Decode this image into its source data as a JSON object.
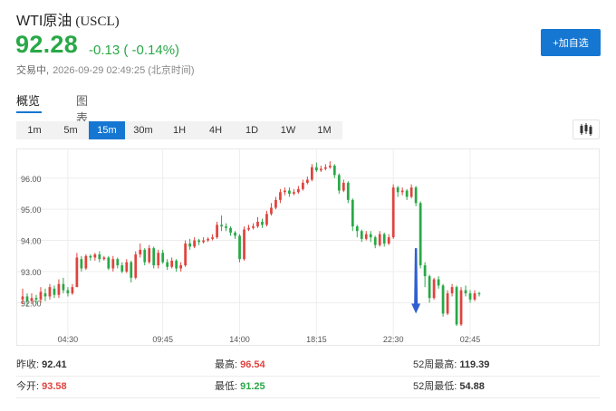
{
  "header": {
    "name": "WTI原油",
    "code": "(USCL)",
    "price": "92.28",
    "change": "-0.13 ( -0.14%)",
    "status": "交易中,",
    "timestamp": "2026-09-29 02:49:25 (北京时间)",
    "watch_label": "+加自选"
  },
  "tabs": [
    {
      "label": "概览",
      "active": true
    },
    {
      "label": "图表",
      "active": false
    }
  ],
  "intervals": [
    {
      "label": "1m",
      "active": false
    },
    {
      "label": "5m",
      "active": false
    },
    {
      "label": "15m",
      "active": true
    },
    {
      "label": "30m",
      "active": false
    },
    {
      "label": "1H",
      "active": false
    },
    {
      "label": "4H",
      "active": false
    },
    {
      "label": "1D",
      "active": false
    },
    {
      "label": "1W",
      "active": false
    },
    {
      "label": "1M",
      "active": false
    }
  ],
  "colors": {
    "up": "#e0433d",
    "down": "#29a847",
    "accent": "#1677d2",
    "annotation_arrow": "#2f5fd0"
  },
  "chart_data": {
    "type": "candlestick",
    "y_ticks": [
      "96.00",
      "95.00",
      "94.00",
      "93.00",
      "92.00"
    ],
    "ylim": [
      91.05,
      96.75
    ],
    "x_ticks": [
      {
        "label": "04:30",
        "index": 10
      },
      {
        "label": "09:45",
        "index": 31
      },
      {
        "label": "14:00",
        "index": 48
      },
      {
        "label": "18:15",
        "index": 65
      },
      {
        "label": "22:30",
        "index": 82
      },
      {
        "label": "02:45",
        "index": 99
      }
    ],
    "grid": true,
    "annotation": {
      "type": "arrow",
      "from": {
        "index": 87,
        "value": 93.75
      },
      "to": {
        "index": 87,
        "value": 91.65
      }
    },
    "candles": [
      [
        92.1,
        92.2,
        92.45,
        91.95
      ],
      [
        92.2,
        92.05,
        92.3,
        91.9
      ],
      [
        92.05,
        92.15,
        92.3,
        91.95
      ],
      [
        92.15,
        92.1,
        92.25,
        91.95
      ],
      [
        92.1,
        92.35,
        92.5,
        92.0
      ],
      [
        92.3,
        92.2,
        92.45,
        92.05
      ],
      [
        92.2,
        92.5,
        92.6,
        92.1
      ],
      [
        92.45,
        92.25,
        92.55,
        92.15
      ],
      [
        92.25,
        92.6,
        92.75,
        92.15
      ],
      [
        92.6,
        92.4,
        92.8,
        92.3
      ],
      [
        92.4,
        92.3,
        92.5,
        92.2
      ],
      [
        92.3,
        92.5,
        92.6,
        92.25
      ],
      [
        92.5,
        93.45,
        93.6,
        92.5
      ],
      [
        93.4,
        93.1,
        93.5,
        93.0
      ],
      [
        93.1,
        93.5,
        93.55,
        93.05
      ],
      [
        93.5,
        93.45,
        93.55,
        93.35
      ],
      [
        93.45,
        93.55,
        93.6,
        93.35
      ],
      [
        93.55,
        93.4,
        93.65,
        93.3
      ],
      [
        93.4,
        93.45,
        93.5,
        93.35
      ],
      [
        93.45,
        93.1,
        93.5,
        93.05
      ],
      [
        93.1,
        93.4,
        93.5,
        93.0
      ],
      [
        93.4,
        93.2,
        93.45,
        93.1
      ],
      [
        93.2,
        93.0,
        93.3,
        92.95
      ],
      [
        93.0,
        93.3,
        93.4,
        92.95
      ],
      [
        93.3,
        92.8,
        93.35,
        92.65
      ],
      [
        92.8,
        93.55,
        93.65,
        92.75
      ],
      [
        93.55,
        93.7,
        93.9,
        93.45
      ],
      [
        93.7,
        93.3,
        93.75,
        93.2
      ],
      [
        93.3,
        93.75,
        93.85,
        93.25
      ],
      [
        93.75,
        93.2,
        93.8,
        93.1
      ],
      [
        93.2,
        93.6,
        93.7,
        93.1
      ],
      [
        93.6,
        93.3,
        93.7,
        93.25
      ],
      [
        93.3,
        93.15,
        93.4,
        93.05
      ],
      [
        93.15,
        93.35,
        93.45,
        93.1
      ],
      [
        93.35,
        93.1,
        93.4,
        93.0
      ],
      [
        93.1,
        93.2,
        93.3,
        93.0
      ],
      [
        93.2,
        93.9,
        94.0,
        93.15
      ],
      [
        93.9,
        93.8,
        94.05,
        93.7
      ],
      [
        93.8,
        94.0,
        94.1,
        93.75
      ],
      [
        94.0,
        93.95,
        94.05,
        93.85
      ],
      [
        93.95,
        94.0,
        94.1,
        93.9
      ],
      [
        94.0,
        94.05,
        94.1,
        93.95
      ],
      [
        94.05,
        94.1,
        94.2,
        94.0
      ],
      [
        94.1,
        94.5,
        94.6,
        94.05
      ],
      [
        94.5,
        94.45,
        94.8,
        94.3
      ],
      [
        94.45,
        94.4,
        94.55,
        94.3
      ],
      [
        94.4,
        94.25,
        94.45,
        94.15
      ],
      [
        94.25,
        94.15,
        94.3,
        94.05
      ],
      [
        94.15,
        93.4,
        94.2,
        93.3
      ],
      [
        93.4,
        94.35,
        94.45,
        93.35
      ],
      [
        94.35,
        94.4,
        94.5,
        94.3
      ],
      [
        94.4,
        94.45,
        94.55,
        94.35
      ],
      [
        94.45,
        94.6,
        94.75,
        94.4
      ],
      [
        94.6,
        94.5,
        94.7,
        94.4
      ],
      [
        94.5,
        94.85,
        94.95,
        94.45
      ],
      [
        94.85,
        95.05,
        95.2,
        94.8
      ],
      [
        95.05,
        95.3,
        95.4,
        95.0
      ],
      [
        95.3,
        95.55,
        95.65,
        95.2
      ],
      [
        95.55,
        95.6,
        95.7,
        95.45
      ],
      [
        95.6,
        95.5,
        95.7,
        95.4
      ],
      [
        95.5,
        95.55,
        95.65,
        95.45
      ],
      [
        95.55,
        95.65,
        95.75,
        95.5
      ],
      [
        95.65,
        95.85,
        95.95,
        95.6
      ],
      [
        95.85,
        95.95,
        96.05,
        95.8
      ],
      [
        95.95,
        96.35,
        96.45,
        95.9
      ],
      [
        96.35,
        96.25,
        96.5,
        96.2
      ],
      [
        96.25,
        96.3,
        96.4,
        96.2
      ],
      [
        96.3,
        96.35,
        96.45,
        96.25
      ],
      [
        96.35,
        96.4,
        96.54,
        96.3
      ],
      [
        96.4,
        96.1,
        96.45,
        96.0
      ],
      [
        96.1,
        95.6,
        96.15,
        95.5
      ],
      [
        95.6,
        95.85,
        95.95,
        95.55
      ],
      [
        95.85,
        95.3,
        95.9,
        95.2
      ],
      [
        95.3,
        94.45,
        95.35,
        94.3
      ],
      [
        94.45,
        94.3,
        94.5,
        94.1
      ],
      [
        94.3,
        94.05,
        94.35,
        93.95
      ],
      [
        94.05,
        94.2,
        94.3,
        94.0
      ],
      [
        94.2,
        94.1,
        94.3,
        93.95
      ],
      [
        94.1,
        93.85,
        94.15,
        93.75
      ],
      [
        93.85,
        94.2,
        94.3,
        93.8
      ],
      [
        94.2,
        93.9,
        94.25,
        93.8
      ],
      [
        93.9,
        94.1,
        94.2,
        93.85
      ],
      [
        94.1,
        95.7,
        95.8,
        94.05
      ],
      [
        95.7,
        95.55,
        95.75,
        95.4
      ],
      [
        95.55,
        95.6,
        95.7,
        95.45
      ],
      [
        95.6,
        95.4,
        95.65,
        95.3
      ],
      [
        95.4,
        95.7,
        95.8,
        95.35
      ],
      [
        95.7,
        95.2,
        95.75,
        95.1
      ],
      [
        95.2,
        93.2,
        95.25,
        93.1
      ],
      [
        93.2,
        92.85,
        93.3,
        92.5
      ],
      [
        92.85,
        92.15,
        92.9,
        92.0
      ],
      [
        92.15,
        92.75,
        92.8,
        92.1
      ],
      [
        92.75,
        92.55,
        92.85,
        92.45
      ],
      [
        92.55,
        91.65,
        92.6,
        91.55
      ],
      [
        91.65,
        92.3,
        92.4,
        91.6
      ],
      [
        92.3,
        92.5,
        92.6,
        92.2
      ],
      [
        92.5,
        91.3,
        92.55,
        91.25
      ],
      [
        91.3,
        92.4,
        92.5,
        91.25
      ],
      [
        92.4,
        92.3,
        92.55,
        92.2
      ],
      [
        92.3,
        92.1,
        92.4,
        92.0
      ],
      [
        92.1,
        92.3,
        92.4,
        92.05
      ],
      [
        92.3,
        92.28,
        92.35,
        92.2
      ]
    ]
  },
  "stats": {
    "prev_close_label": "昨收:",
    "prev_close": "92.41",
    "high_label": "最高:",
    "high": "96.54",
    "high52_label": "52周最高:",
    "high52": "119.39",
    "open_label": "今开:",
    "open": "93.58",
    "low_label": "最低:",
    "low": "91.25",
    "low52_label": "52周最低:",
    "low52": "54.88"
  }
}
